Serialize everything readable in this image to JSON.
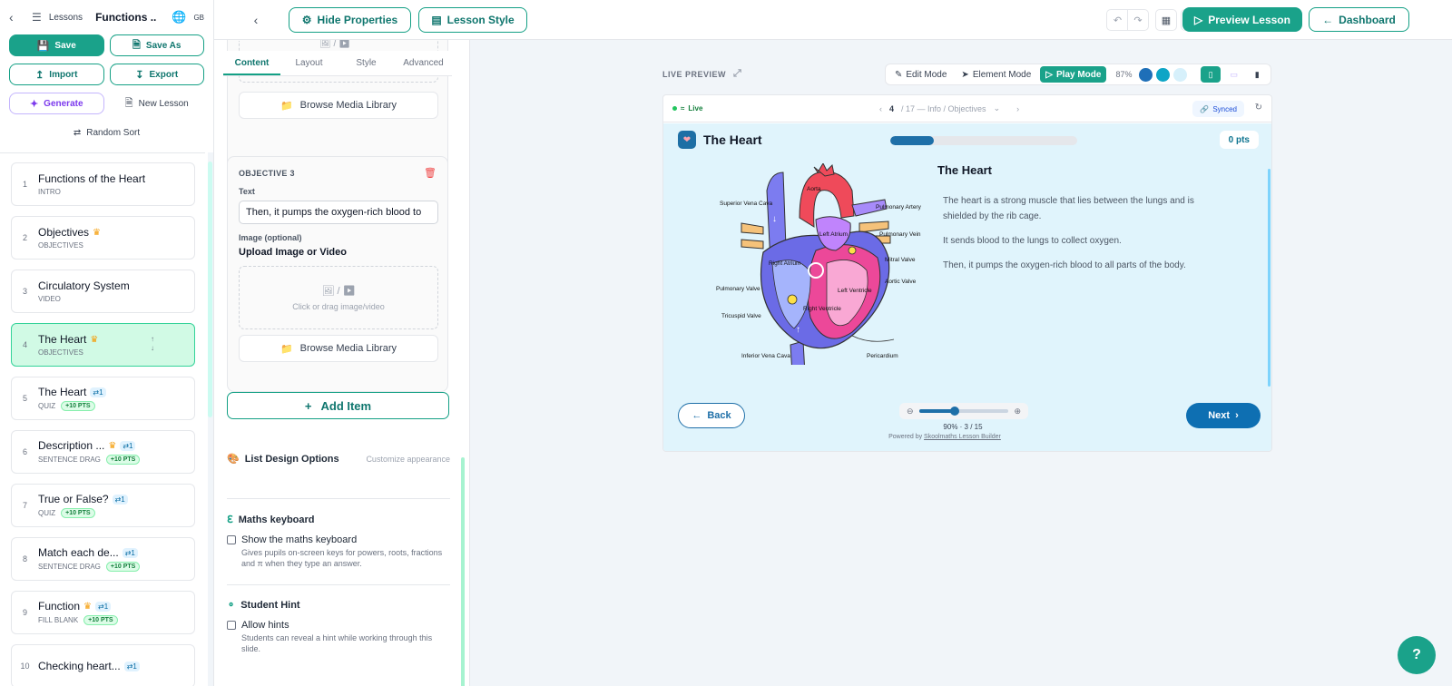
{
  "sidebar": {
    "lessons_label": "Lessons",
    "lesson_title": "Functions ...",
    "lang": "GB",
    "save": "Save",
    "save_as": "Save As",
    "import": "Import",
    "export": "Export",
    "generate": "Generate",
    "new_lesson": "New Lesson",
    "random_sort": "Random Sort",
    "items": [
      {
        "num": "1",
        "title": "Functions of the Heart",
        "type": "INTRO"
      },
      {
        "num": "2",
        "title": "Objectives",
        "type": "OBJECTIVES"
      },
      {
        "num": "3",
        "title": "Circulatory System",
        "type": "VIDEO"
      },
      {
        "num": "4",
        "title": "The Heart",
        "type": "OBJECTIVES"
      },
      {
        "num": "5",
        "title": "The Heart",
        "type": "QUIZ",
        "shuffle": "1",
        "pts": "+10 pts"
      },
      {
        "num": "6",
        "title": "Description ...",
        "type": "SENTENCE DRAG",
        "shuffle": "1",
        "pts": "+10 pts"
      },
      {
        "num": "7",
        "title": "True or False?",
        "type": "QUIZ",
        "shuffle": "1",
        "pts": "+10 pts"
      },
      {
        "num": "8",
        "title": "Match each de...",
        "type": "SENTENCE DRAG",
        "shuffle": "1",
        "pts": "+10 pts"
      },
      {
        "num": "9",
        "title": "Function",
        "type": "FILL BLANK",
        "shuffle": "1",
        "pts": "+10 pts"
      },
      {
        "num": "10",
        "title": "Checking heart...",
        "shuffle": "1"
      }
    ]
  },
  "topbar": {
    "hide_properties": "Hide Properties",
    "lesson_style": "Lesson Style",
    "preview_lesson": "Preview Lesson",
    "dashboard": "Dashboard"
  },
  "panel": {
    "tabs": [
      "Content",
      "Layout",
      "Style",
      "Advanced"
    ],
    "browse_media": "Browse Media Library",
    "objective_label": "OBJECTIVE 3",
    "text_label": "Text",
    "text_value": "Then, it pumps the oxygen-rich blood to",
    "image_label": "Image (optional)",
    "upload_label": "Upload Image or Video",
    "drop_hint": "Click or drag image/video",
    "add_item": "Add Item",
    "list_design": "List Design Options",
    "customize": "Customize appearance",
    "maths_keyboard": "Maths keyboard",
    "show_maths": "Show the maths keyboard",
    "maths_desc": "Gives pupils on-screen keys for powers, roots, fractions and π when they type an answer.",
    "student_hint": "Student Hint",
    "allow_hints": "Allow hints",
    "hint_desc": "Students can reveal a hint while working through this slide."
  },
  "canvas": {
    "live_preview": "LIVE PREVIEW",
    "edit_mode": "Edit Mode",
    "element_mode": "Element Mode",
    "play_mode": "Play Mode",
    "zoom": "87%",
    "theme_colors": [
      "#1e6fb8",
      "#0ea5c6",
      "#d6f0fb"
    ]
  },
  "preview": {
    "live": "Live",
    "slide_current": "4",
    "slide_rest": "/ 17 — Info / Objectives",
    "synced": "Synced",
    "header_title": "The Heart",
    "progress": 0.235,
    "points": "0 pts",
    "content_title": "The Heart",
    "paragraphs": [
      "The heart is a strong muscle that lies between the lungs and is shielded by the rib cage.",
      "It sends blood to the lungs to collect oxygen.",
      "Then, it pumps the oxygen-rich blood to all parts of the body."
    ],
    "diagram_labels": {
      "svc": "Superior Vena Cava",
      "aorta": "Aorta",
      "pa": "Pulmonary Artery",
      "pv": "Pulmonary Vein",
      "la": "Left Atrium",
      "mitral": "Mitral Valve",
      "ra": "Right Atrium",
      "aortic": "Aortic Valve",
      "pulm_valve": "Pulmonary Valve",
      "lv": "Left Ventricle",
      "rv": "Right Ventricle",
      "tricuspid": "Tricuspid Valve",
      "ivc": "Inferior Vena Cava",
      "pericardium": "Pericardium"
    },
    "back": "Back",
    "next": "Next",
    "zoom_info": "90% · 3 / 15",
    "zoom_level": 0.4,
    "powered_prefix": "Powered by",
    "powered_link": "Skoolmaths Lesson Builder"
  },
  "help": "?"
}
